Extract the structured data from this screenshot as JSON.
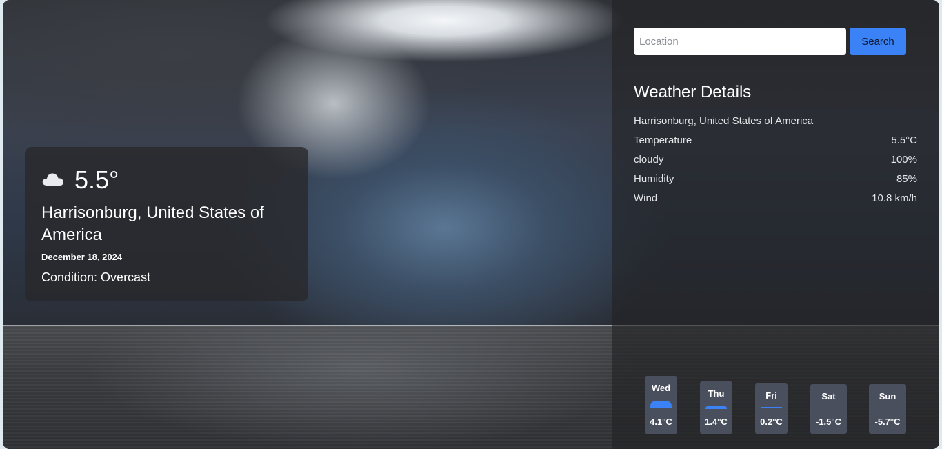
{
  "current": {
    "temperature": "5.5°",
    "location": "Harrisonburg, United States of America",
    "date": "December 18, 2024",
    "condition_text": "Condition: Overcast",
    "icon": "cloud-icon"
  },
  "search": {
    "placeholder": "Location",
    "button_label": "Search"
  },
  "details": {
    "title": "Weather Details",
    "location": "Harrisonburg, United States of America",
    "rows": [
      {
        "label": "Temperature",
        "value": "5.5°C"
      },
      {
        "label": "cloudy",
        "value": "100%"
      },
      {
        "label": "Humidity",
        "value": "85%"
      },
      {
        "label": "Wind",
        "value": "10.8 km/h"
      }
    ]
  },
  "forecast": [
    {
      "day": "Wed",
      "temp": "4.1°C"
    },
    {
      "day": "Thu",
      "temp": "1.4°C"
    },
    {
      "day": "Fri",
      "temp": "0.2°C"
    },
    {
      "day": "Sat",
      "temp": "-1.5°C"
    },
    {
      "day": "Sun",
      "temp": "-5.7°C"
    }
  ],
  "colors": {
    "accent": "#3b82f6",
    "forecast_card": "#4a4f5e"
  }
}
